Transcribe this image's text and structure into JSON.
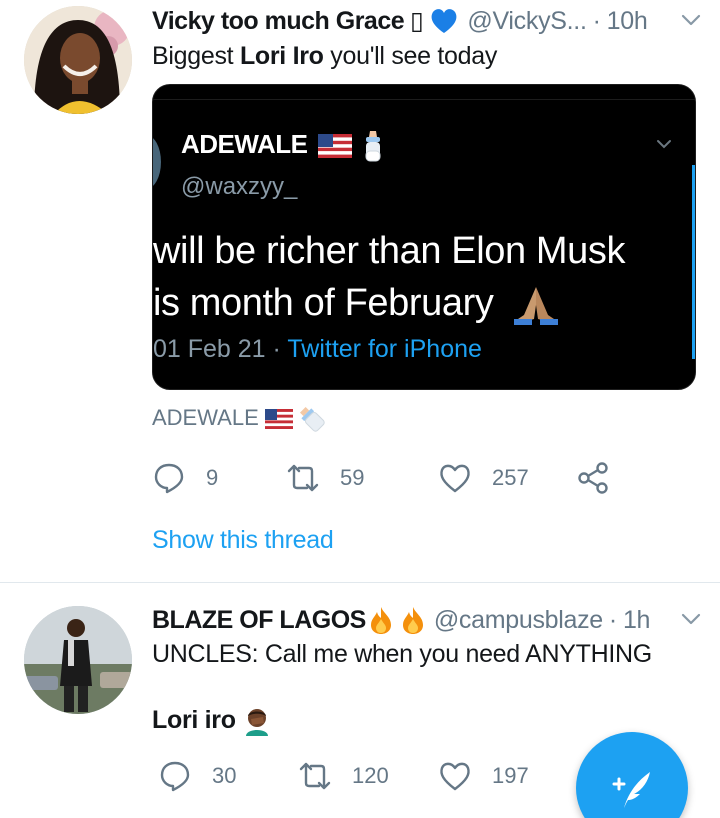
{
  "tweets": [
    {
      "name": "Vicky too much Grace",
      "name_glyph": "▯",
      "handle": "@VickyS...",
      "time": "10h",
      "text_prefix": "Biggest ",
      "text_bold": "Lori Iro",
      "text_suffix": " you'll see today",
      "media": {
        "name": "ADEWALE",
        "handle": "@waxzyy_",
        "text_line1": "will be richer than Elon Musk",
        "text_line2": "is month of February",
        "date": "01 Feb 21",
        "separator": "·",
        "source": "Twitter for iPhone"
      },
      "caption": "ADEWALE",
      "replies": "9",
      "retweets": "59",
      "likes": "257",
      "show_thread": "Show this thread"
    },
    {
      "name": "BLAZE OF LAGOS",
      "handle": "@campusblaze",
      "time": "1h",
      "text_line1": "UNCLES: Call me when you need ANYTHING",
      "text_line2": "Lori iro",
      "replies": "30",
      "retweets": "120",
      "likes": "197"
    }
  ],
  "separator_dot": "·",
  "colors": {
    "accent": "#1da1f2",
    "secondary_text": "#657786",
    "primary_text": "#14171a"
  },
  "icons": [
    "reply-icon",
    "retweet-icon",
    "like-icon",
    "share-icon",
    "chevron-down-icon",
    "compose-tweet-icon",
    "blue-heart-emoji",
    "us-flag-emoji",
    "baby-bottle-emoji",
    "praying-hands-emoji",
    "fire-emoji",
    "facepalm-emoji"
  ]
}
